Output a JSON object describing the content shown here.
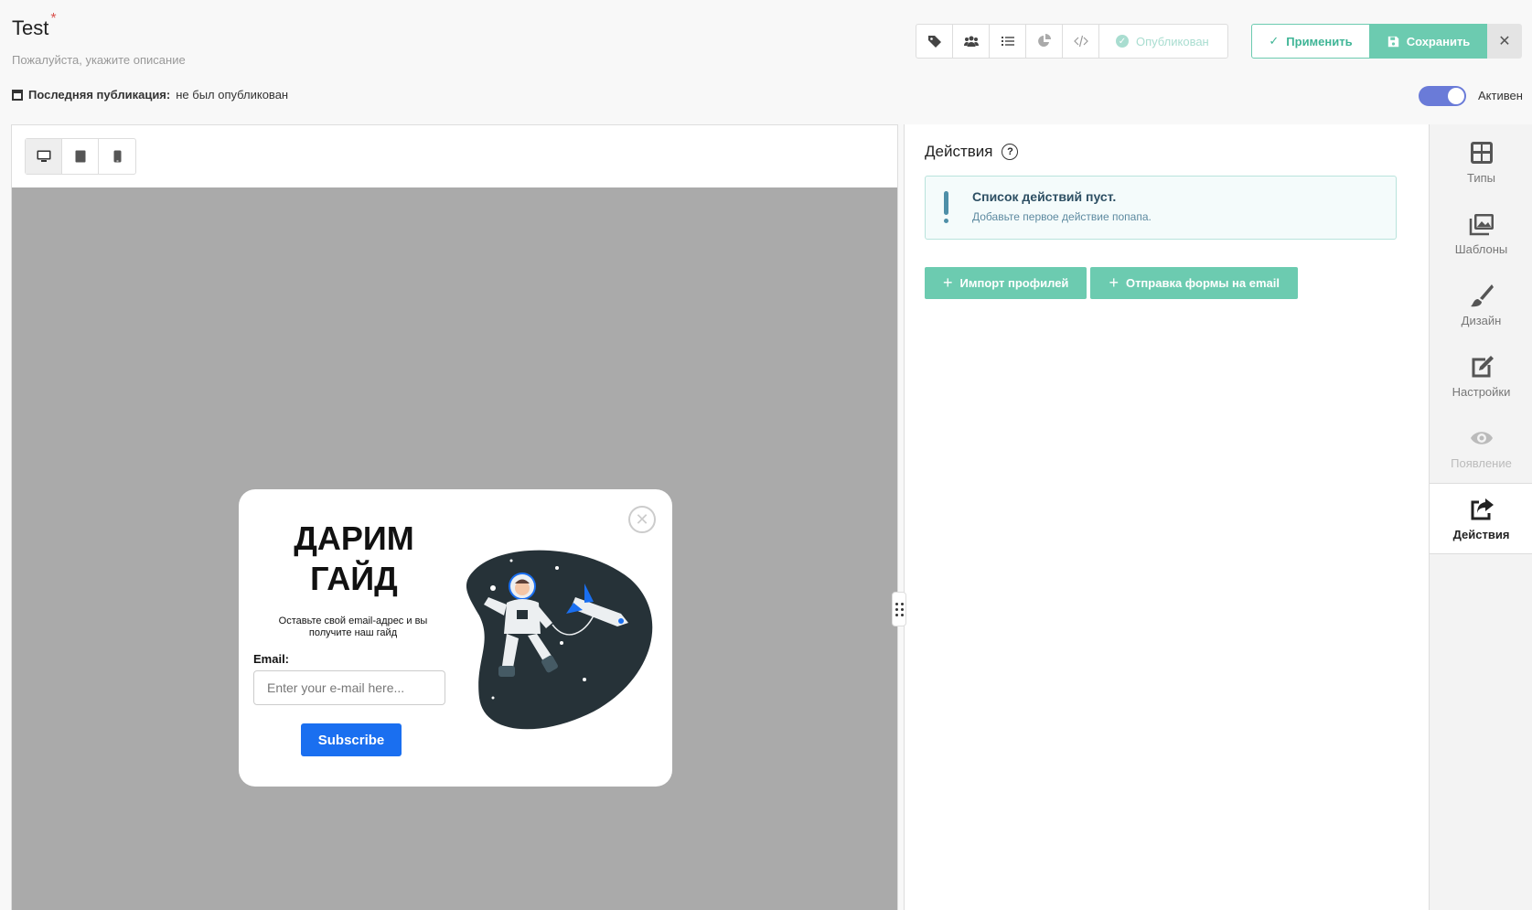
{
  "header": {
    "title": "Test",
    "required_mark": "*",
    "description_placeholder": "Пожалуйста, укажите описание",
    "last_publication_label": "Последняя публикация:",
    "last_publication_value": "не был опубликован",
    "toolbar_icons": [
      "tags-icon",
      "users-icon",
      "list-icon",
      "pie-chart-icon",
      "code-icon"
    ],
    "published_label": "Опубликован",
    "apply_label": "Применить",
    "save_label": "Сохранить",
    "close_symbol": "✕",
    "active_label": "Активен",
    "active": true
  },
  "preview": {
    "devices": [
      "desktop",
      "tablet",
      "mobile"
    ],
    "selected_device": "desktop",
    "popup": {
      "heading": "ДАРИМ ГАЙД",
      "text": "Оставьте свой email-адрес и вы получите наш гайд",
      "email_label": "Email:",
      "email_placeholder": "Enter your e-mail here...",
      "subscribe_label": "Subscribe",
      "close_symbol": "✕"
    }
  },
  "actions_panel": {
    "title": "Действия",
    "help_symbol": "?",
    "alert_title": "Список действий пуст.",
    "alert_text": "Добавьте первое действие попапа.",
    "buttons": [
      {
        "label": "Импорт профилей"
      },
      {
        "label": "Отправка формы на email"
      }
    ]
  },
  "sidebar": {
    "items": [
      {
        "label": "Типы",
        "icon": "grid-icon"
      },
      {
        "label": "Шаблоны",
        "icon": "images-icon"
      },
      {
        "label": "Дизайн",
        "icon": "brush-icon"
      },
      {
        "label": "Настройки",
        "icon": "edit-icon"
      },
      {
        "label": "Появление",
        "icon": "eye-icon",
        "disabled": true
      },
      {
        "label": "Действия",
        "icon": "share-icon",
        "active": true
      }
    ]
  },
  "colors": {
    "accent": "#6ccbb0",
    "toggle": "#6a7bd8",
    "subscribe": "#1a6ff0",
    "canvas": "#aaaaaa"
  }
}
